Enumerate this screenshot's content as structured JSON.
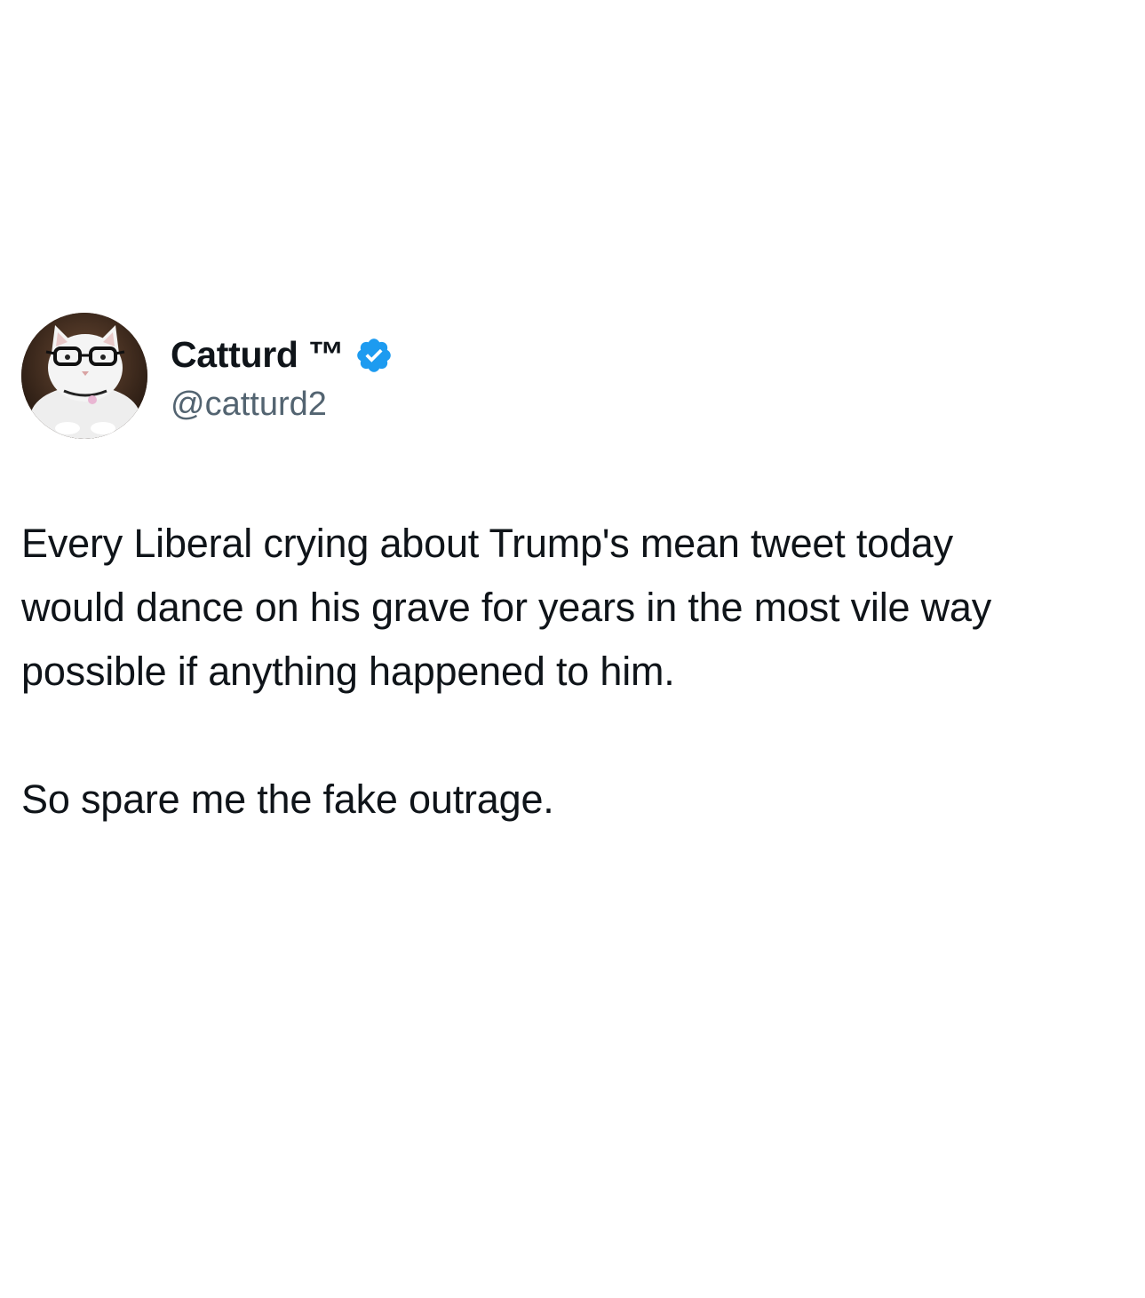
{
  "tweet": {
    "author": {
      "display_name": "Catturd ™",
      "handle": "@catturd2",
      "verified": true,
      "avatar_icon": "cat-with-glasses-avatar",
      "verified_icon": "verified-badge-icon",
      "verified_color": "#1d9bf0"
    },
    "paragraphs": [
      "Every Liberal crying about Trump's mean tweet today would dance on his grave for years in the most vile way possible if anything happened to him.",
      "So spare me the fake outrage."
    ]
  },
  "colors": {
    "text_primary": "#0f1419",
    "text_secondary": "#536471",
    "background": "#ffffff"
  }
}
